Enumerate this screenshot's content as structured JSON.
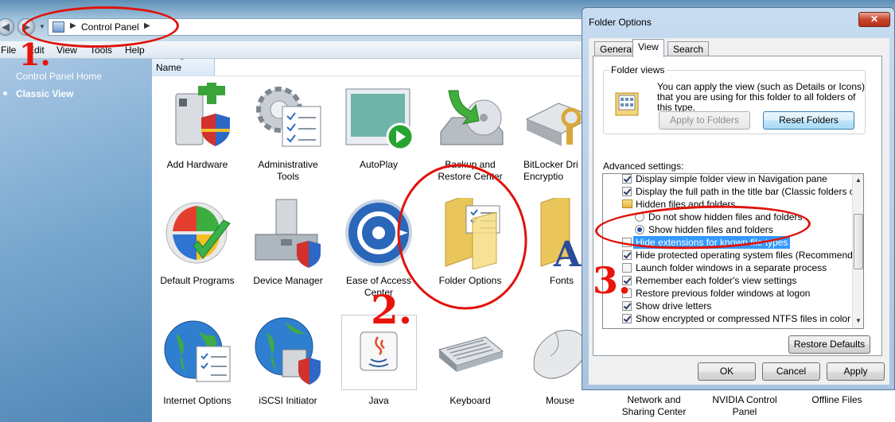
{
  "explorer": {
    "breadcrumb": "Control Panel",
    "menu": [
      "File",
      "Edit",
      "View",
      "Tools",
      "Help"
    ],
    "sidebar": {
      "home": "Control Panel Home",
      "classic": "Classic View"
    },
    "column_header": "Name",
    "items": [
      {
        "label": "Add Hardware",
        "icon": "add-hardware-icon"
      },
      {
        "label": "Administrative\nTools",
        "icon": "administrative-tools-icon"
      },
      {
        "label": "AutoPlay",
        "icon": "autoplay-icon"
      },
      {
        "label": "Backup and\nRestore Center",
        "icon": "backup-icon"
      },
      {
        "label": "BitLocker Dri\nEncryptio",
        "icon": "bitlocker-icon"
      },
      {
        "label": "Default Programs",
        "icon": "default-programs-icon"
      },
      {
        "label": "Device Manager",
        "icon": "device-manager-icon"
      },
      {
        "label": "Ease of Access\nCenter",
        "icon": "ease-of-access-icon"
      },
      {
        "label": "Folder Options",
        "icon": "folder-options-icon"
      },
      {
        "label": "Fonts",
        "icon": "fonts-icon"
      },
      {
        "label": "Internet Options",
        "icon": "internet-options-icon"
      },
      {
        "label": "iSCSI Initiator",
        "icon": "iscsi-icon"
      },
      {
        "label": "Java",
        "icon": "java-icon"
      },
      {
        "label": "Keyboard",
        "icon": "keyboard-icon"
      },
      {
        "label": "Mouse",
        "icon": "mouse-icon"
      },
      {
        "label": "Network and\nSharing Center",
        "icon": "network-icon"
      },
      {
        "label": "NVIDIA Control\nPanel",
        "icon": "nvidia-icon"
      },
      {
        "label": "Offline Files",
        "icon": "offline-files-icon"
      }
    ]
  },
  "annotations": {
    "one": "1.",
    "two": "2.",
    "three": "3."
  },
  "dialog": {
    "title": "Folder Options",
    "close": "✕",
    "tabs": [
      "General",
      "View",
      "Search"
    ],
    "active_tab": "View",
    "folder_views": {
      "legend": "Folder views",
      "description": "You can apply the view (such as Details or Icons) that you are using for this folder to all folders of this type.",
      "apply_button": "Apply to Folders",
      "reset_button": "Reset Folders"
    },
    "advanced_label": "Advanced settings:",
    "settings": [
      {
        "text": "Display simple folder view in Navigation pane",
        "kind": "checkbox",
        "checked": true
      },
      {
        "text": "Display the full path in the title bar (Classic folders only)",
        "kind": "checkbox",
        "checked": true
      },
      {
        "text": "Hidden files and folders",
        "kind": "folder"
      },
      {
        "text": "Do not show hidden files and folders",
        "kind": "radio",
        "checked": false
      },
      {
        "text": "Show hidden files and folders",
        "kind": "radio",
        "checked": true
      },
      {
        "text": "Hide extensions for known file types",
        "kind": "checkbox",
        "checked": false,
        "selected": true
      },
      {
        "text": "Hide protected operating system files (Recommended)",
        "kind": "checkbox",
        "checked": true
      },
      {
        "text": "Launch folder windows in a separate process",
        "kind": "checkbox",
        "checked": false
      },
      {
        "text": "Remember each folder's view settings",
        "kind": "checkbox",
        "checked": true
      },
      {
        "text": "Restore previous folder windows at logon",
        "kind": "checkbox",
        "checked": false
      },
      {
        "text": "Show drive letters",
        "kind": "checkbox",
        "checked": true
      },
      {
        "text": "Show encrypted or compressed NTFS files in color",
        "kind": "checkbox",
        "checked": true
      }
    ],
    "restore_defaults": "Restore Defaults",
    "ok": "OK",
    "cancel": "Cancel",
    "apply": "Apply"
  }
}
